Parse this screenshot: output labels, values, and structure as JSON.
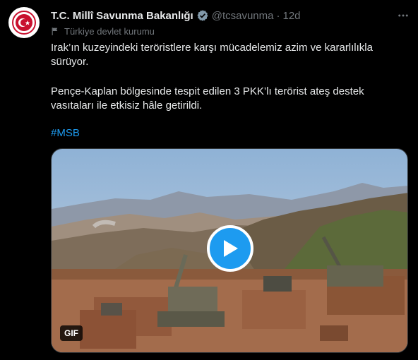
{
  "tweet": {
    "author_name": "T.C. Millî Savunma Bakanlığı",
    "handle": "@tcsavunma",
    "separator": "·",
    "time": "12d",
    "affiliation": "Türkiye devlet kurumu",
    "paragraph1": "Irak’ın kuzeyindeki teröristlere karşı mücadelemiz azim ve kararlılıkla sürüyor.",
    "paragraph2": "Pençe-Kaplan bölgesinde tespit edilen 3 PKK’lı terörist ateş destek vasıtaları ile etkisiz hâle getirildi.",
    "hashtag": "#MSB"
  },
  "media": {
    "badge": "GIF",
    "play_icon": "play-icon"
  },
  "colors": {
    "background": "#000000",
    "text": "#e7e9ea",
    "secondary": "#71767b",
    "accent": "#1d9bf0"
  }
}
